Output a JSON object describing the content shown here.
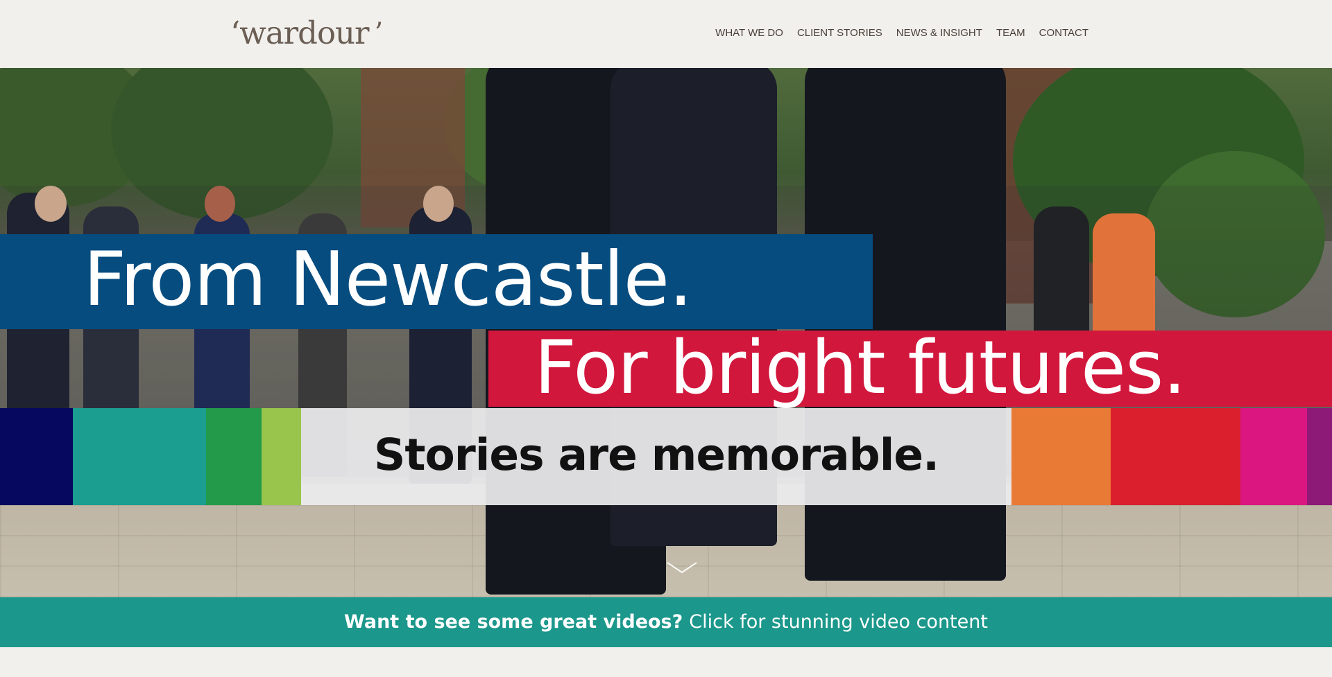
{
  "header": {
    "logo_text": "‘wardour",
    "logo_mark": "’"
  },
  "nav": {
    "items": [
      {
        "label": "WHAT WE DO"
      },
      {
        "label": "CLIENT STORIES"
      },
      {
        "label": "NEWS & INSIGHT"
      },
      {
        "label": "TEAM"
      },
      {
        "label": "CONTACT"
      }
    ]
  },
  "hero": {
    "line1": "From Newcastle.",
    "line2": "For bright futures.",
    "line3": "Stories are memorable.",
    "scroll_icon": "chevron-down-icon",
    "colors": {
      "blue_banner": "#064c7f",
      "red_banner": "#d2173d",
      "stripes": [
        "#05085e",
        "#1b9e90",
        "#229a4a",
        "#99c54c",
        "#e97a35",
        "#db1f2c",
        "#db1681",
        "#8e1a78"
      ]
    }
  },
  "cta": {
    "bold_text": "Want to see some great videos?",
    "text": "Click for stunning video content",
    "color": "#1b978b"
  }
}
